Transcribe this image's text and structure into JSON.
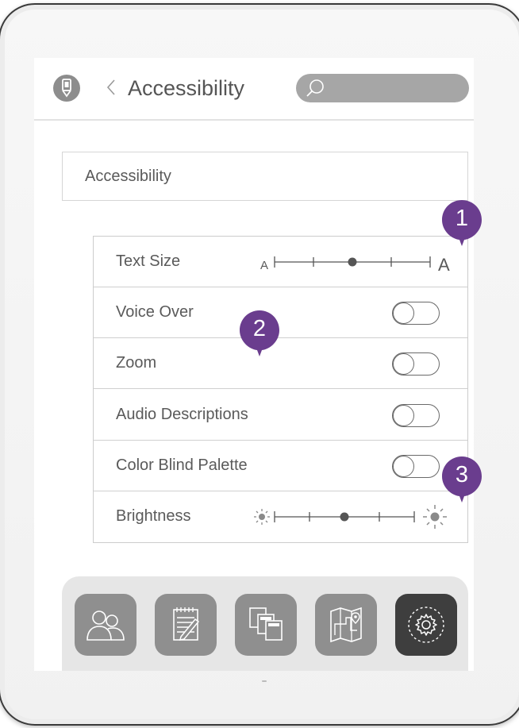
{
  "header": {
    "title": "Accessibility",
    "back_icon": "chevron-left-icon",
    "app_icon": "pencil-icon",
    "search": {
      "placeholder": "",
      "icon": "search-icon"
    }
  },
  "section": {
    "label": "Accessibility"
  },
  "settings": [
    {
      "label": "Text Size",
      "control": "slider",
      "slider": {
        "min_label": "A",
        "max_label": "A",
        "value": 0.5
      }
    },
    {
      "label": "Voice Over",
      "control": "toggle",
      "on": false
    },
    {
      "label": "Zoom",
      "control": "toggle",
      "on": false
    },
    {
      "label": "Audio Descriptions",
      "control": "toggle",
      "on": false
    },
    {
      "label": "Color Blind Palette",
      "control": "toggle",
      "on": false
    },
    {
      "label": "Brightness",
      "control": "slider",
      "slider": {
        "min_icon": "sun-small-icon",
        "max_icon": "sun-large-icon",
        "value": 0.5
      }
    }
  ],
  "dock": {
    "items": [
      {
        "icon": "people-icon",
        "active": false
      },
      {
        "icon": "notepad-icon",
        "active": false
      },
      {
        "icon": "windows-icon",
        "active": false
      },
      {
        "icon": "map-icon",
        "active": false
      },
      {
        "icon": "settings-gear-icon",
        "active": true
      }
    ]
  },
  "annotations": [
    {
      "number": "1"
    },
    {
      "number": "2"
    },
    {
      "number": "3"
    }
  ],
  "colors": {
    "badge": "#6a3d8e",
    "text": "#5a5a5a",
    "icon_button": "#8f8f8f",
    "active_button": "#3e3e3e"
  }
}
